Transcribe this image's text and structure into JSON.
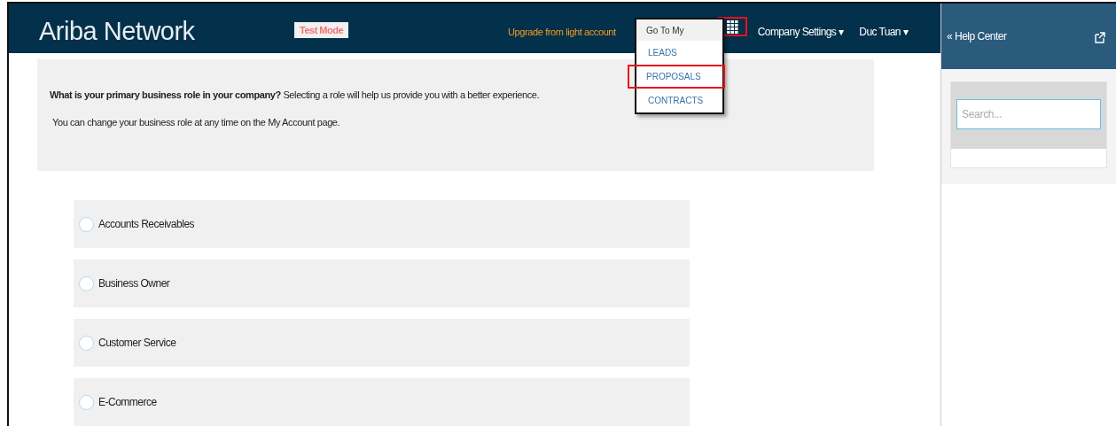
{
  "header": {
    "logo": "Ariba Network",
    "test_mode": "Test Mode",
    "upgrade_link": "Upgrade from light account",
    "apps_button": {
      "highlighted": true
    },
    "menus": [
      {
        "label": "Company Settings",
        "caret": "▾"
      },
      {
        "label": "Duc Tuan",
        "caret": "▾"
      }
    ]
  },
  "goto_menu": {
    "title": "Go To My",
    "items": [
      {
        "label": "LEADS",
        "highlighted": false
      },
      {
        "label": "PROPOSALS",
        "highlighted": true
      },
      {
        "label": "CONTRACTS",
        "highlighted": false
      }
    ]
  },
  "help_panel": {
    "title": "Help Center",
    "collapse_icon": "«",
    "search": {
      "placeholder": "Search..."
    }
  },
  "prompt": {
    "question": "**What is your primary business role in your company?** Selecting a role will help us provide you with a better experience.",
    "note": "You can change your business role at any time on the My Account page."
  },
  "roles": [
    {
      "label": "Accounts Receivables",
      "selected": false
    },
    {
      "label": "Business Owner",
      "selected": false
    },
    {
      "label": "Customer Service",
      "selected": false
    },
    {
      "label": "E-Commerce",
      "selected": false
    }
  ]
}
